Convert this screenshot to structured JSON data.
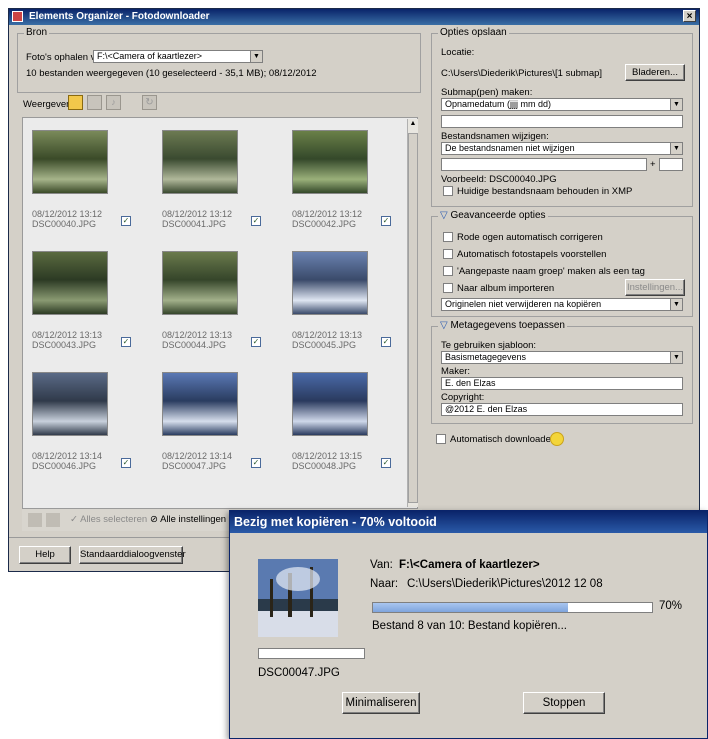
{
  "window": {
    "title": "Elements Organizer - Fotodownloader",
    "close": "×"
  },
  "bron": {
    "group_label": "Bron",
    "fetch_label": "Foto's ophalen van:",
    "fetch_value": "F:\\<Camera of kaartlezer>",
    "summary": "10 bestanden weergegeven (10 geselecteerd - 35,1 MB); 08/12/2012"
  },
  "view": {
    "label": "Weergeven:",
    "icons": [
      "photo-view-icon",
      "video-view-icon",
      "audio-view-icon",
      "rotate-icon"
    ]
  },
  "thumbnails": [
    {
      "date": "08/12/2012 13:12",
      "file": "DSC00040.JPG",
      "checked": "✓"
    },
    {
      "date": "08/12/2012 13:12",
      "file": "DSC00041.JPG",
      "checked": "✓"
    },
    {
      "date": "08/12/2012 13:12",
      "file": "DSC00042.JPG",
      "checked": "✓"
    },
    {
      "date": "08/12/2012 13:13",
      "file": "DSC00043.JPG",
      "checked": "✓"
    },
    {
      "date": "08/12/2012 13:13",
      "file": "DSC00044.JPG",
      "checked": "✓"
    },
    {
      "date": "08/12/2012 13:13",
      "file": "DSC00045.JPG",
      "checked": "✓"
    },
    {
      "date": "08/12/2012 13:14",
      "file": "DSC00046.JPG",
      "checked": "✓"
    },
    {
      "date": "08/12/2012 13:14",
      "file": "DSC00047.JPG",
      "checked": "✓"
    },
    {
      "date": "08/12/2012 13:15",
      "file": "DSC00048.JPG",
      "checked": "✓"
    }
  ],
  "bottom_toolbar": {
    "select_all": "Alles selecteren",
    "deselect_all": "Alle instellingen dese"
  },
  "footer": {
    "help": "Help",
    "standard_dialog": "Standaarddialoogvenster"
  },
  "save_options": {
    "group_label": "Opties opslaan",
    "location_label": "Locatie:",
    "location_value": "C:\\Users\\Diederik\\Pictures\\[1 submap]",
    "browse": "Bladeren...",
    "subfolder_label": "Submap(pen) maken:",
    "subfolder_value": "Opnamedatum (jjjj mm dd)",
    "rename_label": "Bestandsnamen wijzigen:",
    "rename_value": "De bestandsnamen niet wijzigen",
    "plus": "+",
    "example": "Voorbeeld: DSC00040.JPG",
    "keep_name": "Huidige bestandsnaam behouden in XMP"
  },
  "advanced": {
    "group_label": "Geavanceerde opties",
    "red_eye": "Rode ogen automatisch corrigeren",
    "stacks": "Automatisch fotostapels voorstellen",
    "custom_group": "'Aangepaste naam groep' maken als een tag",
    "album": "Naar album importeren",
    "settings": "Instellingen...",
    "delete_value": "Originelen niet verwijderen na kopiëren"
  },
  "metadata": {
    "group_label": "Metagegevens toepassen",
    "template_label": "Te gebruiken sjabloon:",
    "template_value": "Basismetagegevens",
    "maker_label": "Maker:",
    "maker_value": "E. den Elzas",
    "copyright_label": "Copyright:",
    "copyright_value": "@2012 E. den Elzas"
  },
  "auto_download": "Automatisch downloaden",
  "progress_dialog": {
    "title": "Bezig met kopiëren - 70% voltooid",
    "from_label": "Van:",
    "from_value": "F:\\<Camera of kaartlezer>",
    "to_label": "Naar:",
    "to_value": "C:\\Users\\Diederik\\Pictures\\2012 12 08",
    "progress": 0.7,
    "percent": "70%",
    "status": "Bestand 8 van 10: Bestand kopiëren...",
    "file": "DSC00047.JPG",
    "minimize": "Minimaliseren",
    "stop": "Stoppen"
  },
  "colors": {
    "titlebar": "#0a246a",
    "window_bg": "#d4d0c8",
    "progress_fill": "#7fa4dc"
  }
}
